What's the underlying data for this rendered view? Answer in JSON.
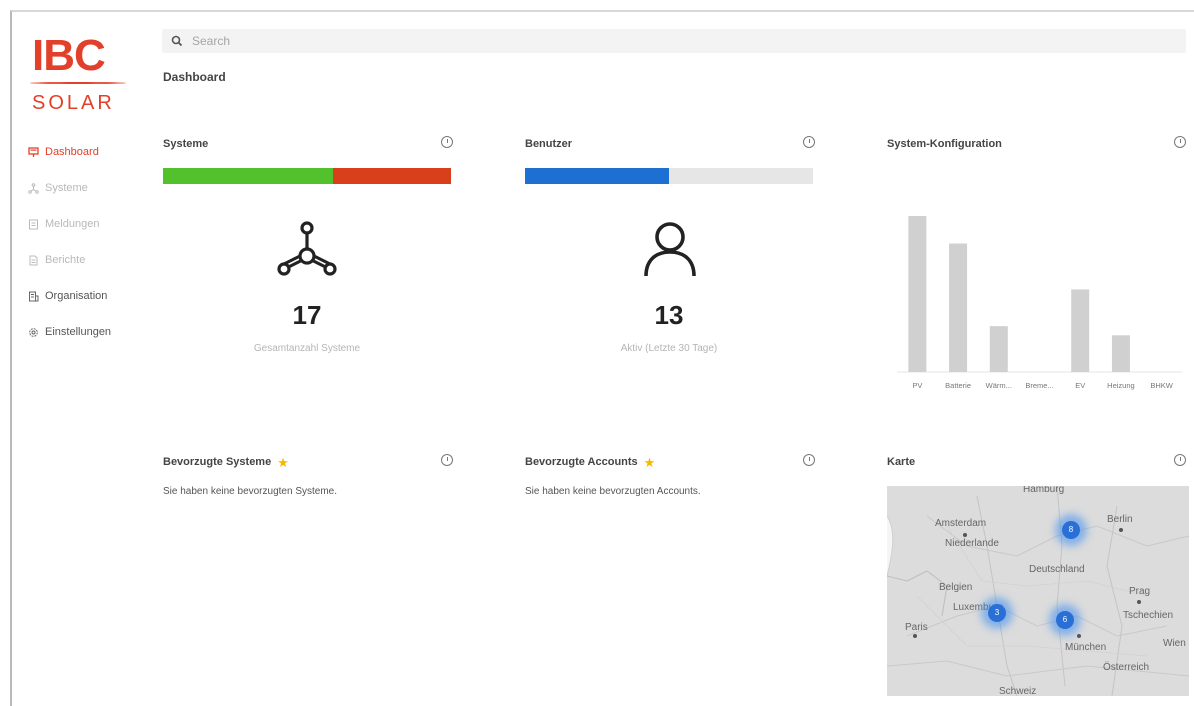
{
  "logo": {
    "brand": "IBC",
    "sub": "SOLAR"
  },
  "sidebar": {
    "items": [
      {
        "label": "Dashboard",
        "icon": "dashboard-icon"
      },
      {
        "label": "Systeme",
        "icon": "systems-icon"
      },
      {
        "label": "Meldungen",
        "icon": "messages-icon"
      },
      {
        "label": "Berichte",
        "icon": "reports-icon"
      },
      {
        "label": "Organisation",
        "icon": "organisation-icon"
      },
      {
        "label": "Einstellungen",
        "icon": "settings-icon"
      }
    ]
  },
  "search": {
    "placeholder": "Search"
  },
  "page": {
    "title": "Dashboard"
  },
  "cards": {
    "systeme": {
      "title": "Systeme",
      "count": "17",
      "label": "Gesamtanzahl Systeme",
      "bar": {
        "green_fraction": 0.59,
        "red_fraction": 0.41,
        "green": "#52c12b",
        "red": "#d8401c"
      }
    },
    "benutzer": {
      "title": "Benutzer",
      "count": "13",
      "label": "Aktiv (Letzte 30 Tage)",
      "bar": {
        "blue_fraction": 0.5,
        "blue": "#1e6fd2",
        "rest": "#e6e6e6"
      }
    },
    "config": {
      "title": "System-Konfiguration"
    },
    "fav_systems": {
      "title": "Bevorzugte Systeme",
      "empty": "Sie haben keine bevorzugten Systeme."
    },
    "fav_accounts": {
      "title": "Bevorzugte Accounts",
      "empty": "Sie haben keine bevorzugten Accounts."
    },
    "map": {
      "title": "Karte",
      "labels": [
        "Hamburg",
        "Amsterdam",
        "Niederlande",
        "Berlin",
        "Deutschland",
        "Belgien",
        "Luxemburg",
        "Prag",
        "Tschechien",
        "Paris",
        "München",
        "Wien",
        "Österreich",
        "Schweiz"
      ],
      "clusters": [
        "8",
        "3",
        "6"
      ]
    }
  },
  "chart_data": {
    "type": "bar",
    "categories": [
      "PV",
      "Batterie",
      "Wärm...",
      "Breme...",
      "EV",
      "Heizung",
      "BHKW"
    ],
    "values": [
      17,
      14,
      5,
      0,
      9,
      4,
      0
    ],
    "ylim": [
      0,
      17
    ],
    "color": "#d0d0d0"
  }
}
